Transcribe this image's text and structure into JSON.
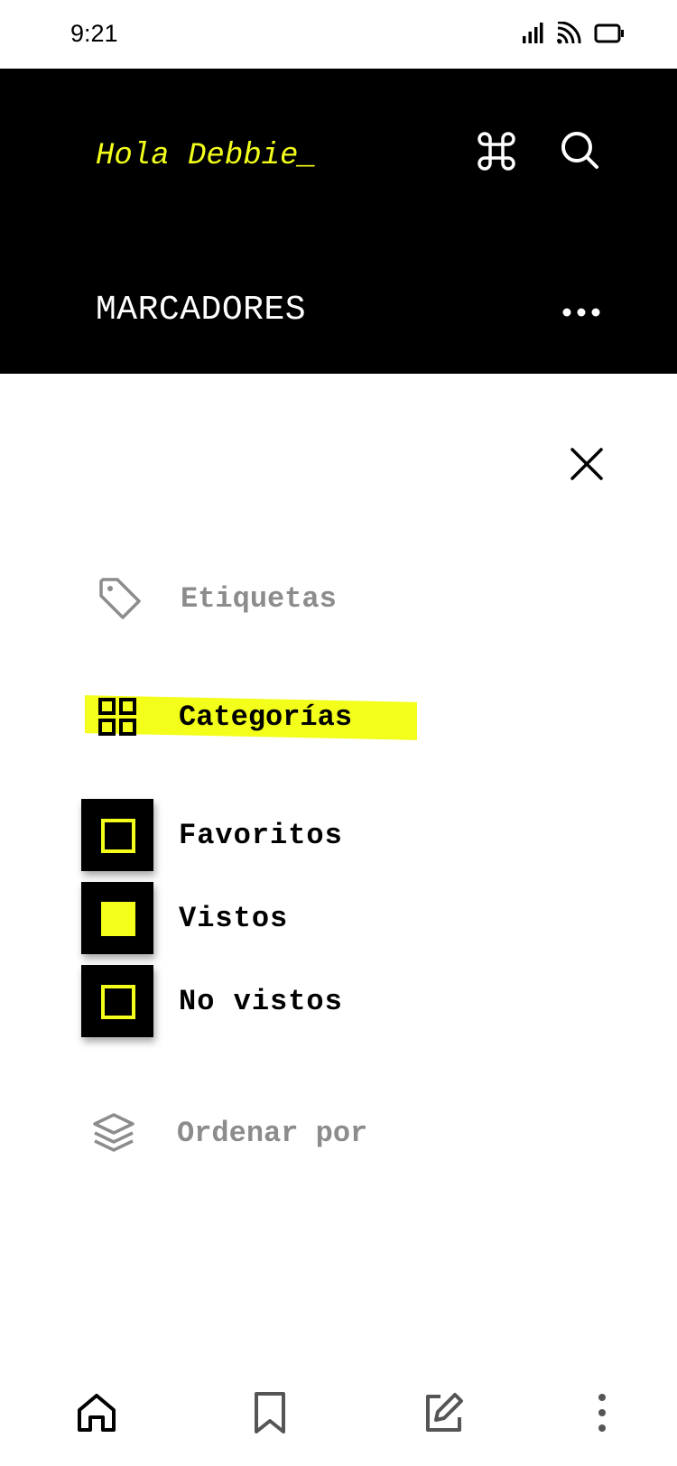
{
  "status_bar": {
    "time": "9:21"
  },
  "header": {
    "greeting": "Hola Debbie_",
    "section_title": "MARCADORES"
  },
  "filters": {
    "tags_label": "Etiquetas",
    "categories_label": "Categorías",
    "categories": [
      {
        "label": "Favoritos",
        "checked": false
      },
      {
        "label": "Vistos",
        "checked": true
      },
      {
        "label": "No vistos",
        "checked": false
      }
    ],
    "sort_label": "Ordenar por"
  },
  "colors": {
    "accent": "#f3ff1a",
    "header_bg": "#000000",
    "muted_text": "#8c8c8c"
  },
  "icons": {
    "header": [
      "command-icon",
      "search-icon",
      "more-horizontal-icon"
    ],
    "bottom_nav": [
      "home-icon",
      "bookmark-icon",
      "edit-icon",
      "more-vertical-icon"
    ]
  }
}
